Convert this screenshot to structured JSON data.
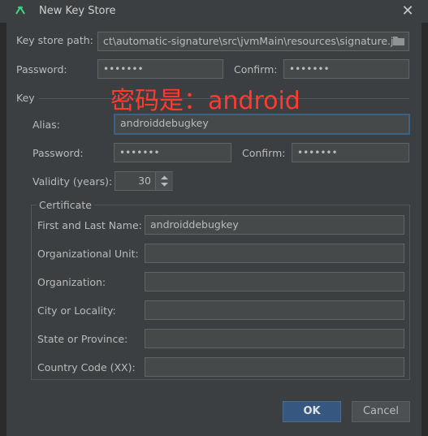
{
  "window": {
    "title": "New Key Store"
  },
  "keystore": {
    "path_label": "Key store path:",
    "path_value": "ct\\automatic-signature\\src\\jvmMain\\resources\\signature.jks",
    "password_label": "Password:",
    "password_value": "•••••••",
    "confirm_label": "Confirm:",
    "confirm_value": "•••••••"
  },
  "annotation": "密码是：android",
  "key": {
    "group_label": "Key",
    "alias_label": "Alias:",
    "alias_value": "androiddebugkey",
    "password_label": "Password:",
    "password_value": "•••••••",
    "confirm_label": "Confirm:",
    "confirm_value": "•••••••",
    "validity_label": "Validity (years):",
    "validity_value": "30"
  },
  "certificate": {
    "group_label": "Certificate",
    "fields": [
      {
        "label": "First and Last Name:",
        "value": "androiddebugkey"
      },
      {
        "label": "Organizational Unit:",
        "value": ""
      },
      {
        "label": "Organization:",
        "value": ""
      },
      {
        "label": "City or Locality:",
        "value": ""
      },
      {
        "label": "State or Province:",
        "value": ""
      },
      {
        "label": "Country Code (XX):",
        "value": ""
      }
    ]
  },
  "buttons": {
    "ok": "OK",
    "cancel": "Cancel"
  },
  "colors": {
    "background": "#3c3f41",
    "field": "#45494a",
    "focus": "#3d6185",
    "primary": "#365880",
    "annotation": "#ff3b30"
  }
}
